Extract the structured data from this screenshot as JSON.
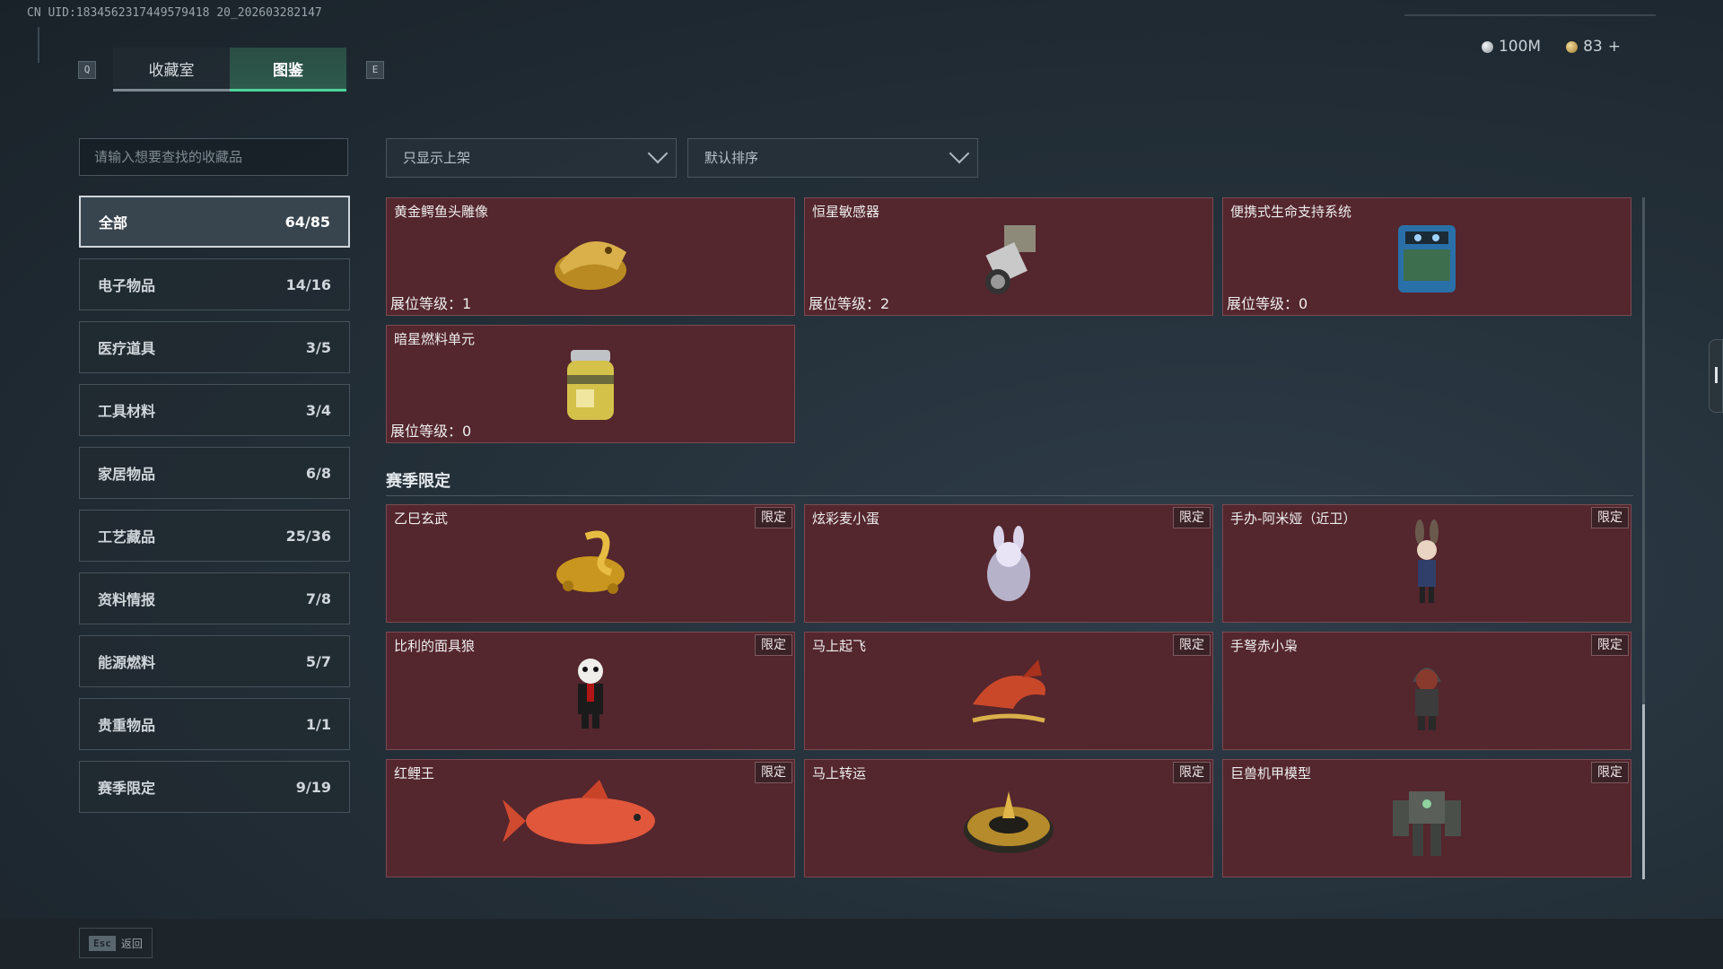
{
  "uid": "CN UID:1834562317449579418 20_202603282147",
  "tabs": {
    "left_key": "Q",
    "right_key": "E",
    "items": [
      {
        "label": "收藏室"
      },
      {
        "label": "图鉴"
      }
    ],
    "active_index": 1
  },
  "currency": {
    "silver": {
      "value": "100M",
      "icon": "silver-coin-icon"
    },
    "gold": {
      "value": "83",
      "plus": "+",
      "icon": "gold-coin-icon"
    }
  },
  "search": {
    "placeholder": "请输入想要查找的收藏品"
  },
  "filters": {
    "display": {
      "value": "只显示上架"
    },
    "sort": {
      "value": "默认排序"
    }
  },
  "categories": [
    {
      "label": "全部",
      "count": "64/85"
    },
    {
      "label": "电子物品",
      "count": "14/16"
    },
    {
      "label": "医疗道具",
      "count": "3/5"
    },
    {
      "label": "工具材料",
      "count": "3/4"
    },
    {
      "label": "家居物品",
      "count": "6/8"
    },
    {
      "label": "工艺藏品",
      "count": "25/36"
    },
    {
      "label": "资料情报",
      "count": "7/8"
    },
    {
      "label": "能源燃料",
      "count": "5/7"
    },
    {
      "label": "贵重物品",
      "count": "1/1"
    },
    {
      "label": "赛季限定",
      "count": "9/19"
    }
  ],
  "items_top": [
    {
      "name": "黄金鳄鱼头雕像",
      "level": "展位等级：1"
    },
    {
      "name": "恒星敏感器",
      "level": "展位等级：2"
    },
    {
      "name": "便携式生命支持系统",
      "level": "展位等级：0"
    },
    {
      "name": "暗星燃料单元",
      "level": "展位等级：0"
    }
  ],
  "season": {
    "title": "赛季限定",
    "badge": "限定",
    "items": [
      {
        "name": "乙巳玄武"
      },
      {
        "name": "炫彩麦小蛋"
      },
      {
        "name": "手办-阿米娅（近卫）"
      },
      {
        "name": "比利的面具狼"
      },
      {
        "name": "马上起飞"
      },
      {
        "name": "手弩赤小枭"
      },
      {
        "name": "红鲤王"
      },
      {
        "name": "马上转运"
      },
      {
        "name": "巨兽机甲模型"
      }
    ]
  },
  "footer": {
    "esc_key": "Esc",
    "back_label": "返回"
  }
}
